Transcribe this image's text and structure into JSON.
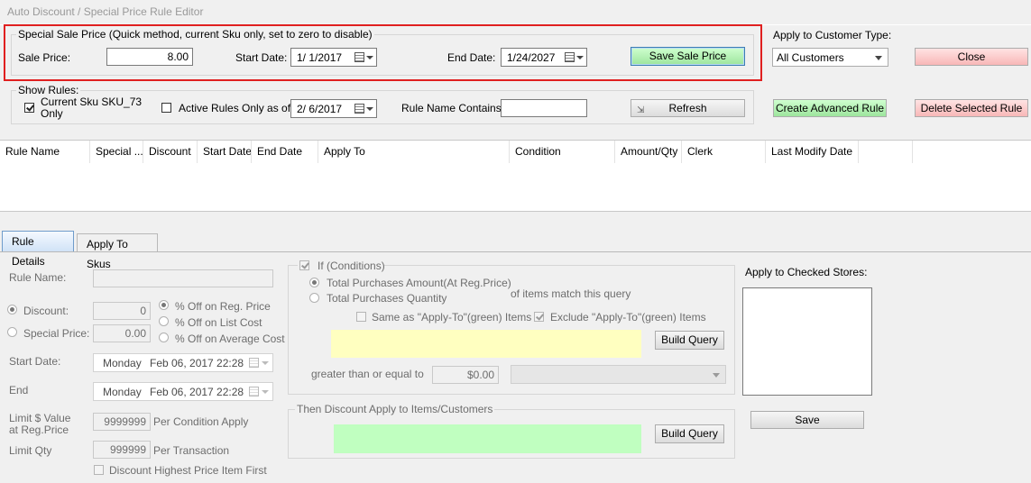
{
  "window": {
    "title": "Auto Discount / Special Price Rule Editor"
  },
  "sale": {
    "group_label": "Special Sale Price (Quick method, current Sku only, set to zero to disable)",
    "price_label": "Sale Price:",
    "price_value": "8.00",
    "start_label": "Start Date:",
    "start_value": "1/  1/2017",
    "end_label": "End Date:",
    "end_value": "1/24/2027",
    "save_button": "Save Sale Price"
  },
  "customer_type": {
    "label": "Apply to Customer Type:",
    "selected": "All Customers"
  },
  "close_button": "Close",
  "show_rules": {
    "group_label": "Show Rules:",
    "current_sku_label_line1": "Current Sku SKU_73",
    "current_sku_label_line2": "Only",
    "current_sku_checked": true,
    "active_rules_label": "Active Rules Only as of",
    "active_rules_checked": false,
    "active_date": "2/  6/2017",
    "name_contains_label": "Rule Name Contains:",
    "name_contains_value": "",
    "refresh_button": "Refresh"
  },
  "create_advanced_button": "Create Advanced Rule",
  "delete_selected_button": "Delete Selected Rule",
  "grid": {
    "columns": [
      "Rule Name",
      "Special ...",
      "Discount",
      "Start Date",
      "End Date",
      "Apply To",
      "Condition",
      "Amount/Qty",
      "Clerk",
      "Last Modify Date"
    ],
    "rows": []
  },
  "tabs": [
    {
      "label": "Rule Details",
      "active": true
    },
    {
      "label": "Apply To Skus",
      "active": false
    }
  ],
  "details": {
    "rule_name_label": "Rule Name:",
    "discount_label": "Discount:",
    "discount_value": "0",
    "special_price_label": "Special Price:",
    "special_price_value": "0.00",
    "off_reg_label": "% Off on Reg. Price",
    "off_list_label": "% Off on List Cost",
    "off_avg_label": "% Off on Average Cost",
    "start_label": "Start Date:",
    "start_day": "Monday",
    "start_value": "Feb 06, 2017 22:28",
    "end_label": "End",
    "end_day": "Monday",
    "end_value": "Feb 06, 2017 22:28",
    "limit_value_label_line1": "Limit $ Value",
    "limit_value_label_line2": "at Reg.Price",
    "limit_value": "9999999",
    "per_condition_label": "Per Condition Apply",
    "limit_qty_label": "Limit Qty",
    "limit_qty_value": "999999",
    "per_transaction_label": "Per Transaction",
    "highest_first_label": "Discount Highest Price Item First"
  },
  "conditions": {
    "group_label": "If (Conditions)",
    "total_amount_label": "Total Purchases Amount(At Reg.Price)",
    "total_qty_label": "Total Purchases Quantity",
    "items_match_label": "of items match this query",
    "same_as_label": "Same  as \"Apply-To\"(green) Items",
    "exclude_label": "Exclude \"Apply-To\"(green) Items",
    "build_query_button": "Build Query",
    "gte_label": "greater than or equal to",
    "gte_value": "$0.00"
  },
  "then_discount": {
    "group_label": "Then Discount Apply to Items/Customers",
    "build_query_button": "Build Query"
  },
  "stores": {
    "label": "Apply to Checked Stores:",
    "save_button": "Save"
  },
  "colors": {
    "highlight_border": "#e02020",
    "green_button": "#9de59d",
    "pink_button": "#f8b7b7",
    "query_yellow": "#ffffc0",
    "query_green": "#c0ffc0"
  }
}
